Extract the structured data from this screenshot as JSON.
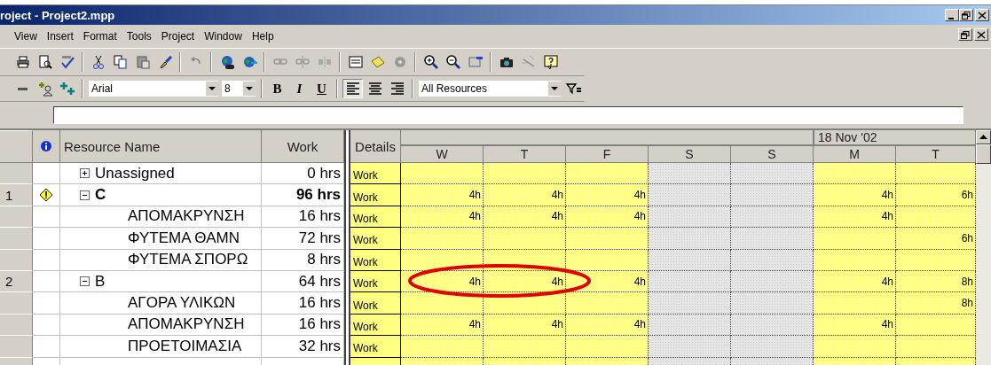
{
  "window": {
    "title": "roject - Project2.mpp"
  },
  "menu": [
    "View",
    "Insert",
    "Format",
    "Tools",
    "Project",
    "Window",
    "Help"
  ],
  "formatting": {
    "font": "Arial",
    "size": "8",
    "bold": "B",
    "italic": "I",
    "underline": "U",
    "filter": "All Resources"
  },
  "table": {
    "columns": [
      "Resource Name",
      "Work"
    ],
    "details_header": "Details",
    "date_label": "18 Nov '02",
    "days": [
      {
        "label": "W",
        "weekend": false
      },
      {
        "label": "T",
        "weekend": false
      },
      {
        "label": "F",
        "weekend": false
      },
      {
        "label": "S",
        "weekend": true
      },
      {
        "label": "S",
        "weekend": true
      },
      {
        "label": "M",
        "weekend": false
      },
      {
        "label": "T",
        "weekend": false
      }
    ],
    "rows": [
      {
        "kind": "group",
        "number": "",
        "warning": false,
        "expanded": false,
        "name": "Unassigned",
        "work": "0 hrs",
        "bold": false,
        "detail": "Work",
        "cells": [
          "",
          "",
          "",
          "",
          "",
          "",
          ""
        ]
      },
      {
        "kind": "group",
        "number": "1",
        "warning": true,
        "expanded": true,
        "name": "C",
        "work": "96 hrs",
        "bold": true,
        "detail": "Work",
        "cells": [
          "4h",
          "4h",
          "4h",
          "",
          "",
          "4h",
          "6h"
        ]
      },
      {
        "kind": "resource",
        "number": "",
        "warning": false,
        "name": "ΑΠΟΜΑΚΡΥΝΣΗ",
        "work": "16 hrs",
        "bold": false,
        "detail": "Work",
        "cells": [
          "4h",
          "4h",
          "4h",
          "",
          "",
          "4h",
          ""
        ]
      },
      {
        "kind": "resource",
        "number": "",
        "warning": false,
        "name": "ΦΥΤΕΜΑ ΘΑΜΝ",
        "work": "72 hrs",
        "bold": false,
        "detail": "Work",
        "cells": [
          "",
          "",
          "",
          "",
          "",
          "",
          "6h"
        ]
      },
      {
        "kind": "resource",
        "number": "",
        "warning": false,
        "name": "ΦΥΤΕΜΑ ΣΠΟΡΩ",
        "work": "8 hrs",
        "bold": false,
        "detail": "Work",
        "cells": [
          "",
          "",
          "",
          "",
          "",
          "",
          ""
        ]
      },
      {
        "kind": "group",
        "number": "2",
        "warning": false,
        "expanded": true,
        "name": "B",
        "work": "64 hrs",
        "bold": false,
        "detail": "Work",
        "cells": [
          "4h",
          "4h",
          "4h",
          "",
          "",
          "4h",
          "8h"
        ]
      },
      {
        "kind": "resource",
        "number": "",
        "warning": false,
        "name": "ΑΓΟΡΑ ΥΛΙΚΩΝ",
        "work": "16 hrs",
        "bold": false,
        "detail": "Work",
        "cells": [
          "",
          "",
          "",
          "",
          "",
          "",
          "8h"
        ]
      },
      {
        "kind": "resource",
        "number": "",
        "warning": false,
        "name": "ΑΠΟΜΑΚΡΥΝΣΗ",
        "work": "16 hrs",
        "bold": false,
        "detail": "Work",
        "cells": [
          "4h",
          "4h",
          "4h",
          "",
          "",
          "4h",
          ""
        ]
      },
      {
        "kind": "resource",
        "number": "",
        "warning": false,
        "name": "ΠΡΟΕΤΟΙΜΑΣΙΑ",
        "work": "32 hrs",
        "bold": false,
        "detail": "Work",
        "cells": [
          "",
          "",
          "",
          "",
          "",
          "",
          ""
        ]
      }
    ]
  }
}
